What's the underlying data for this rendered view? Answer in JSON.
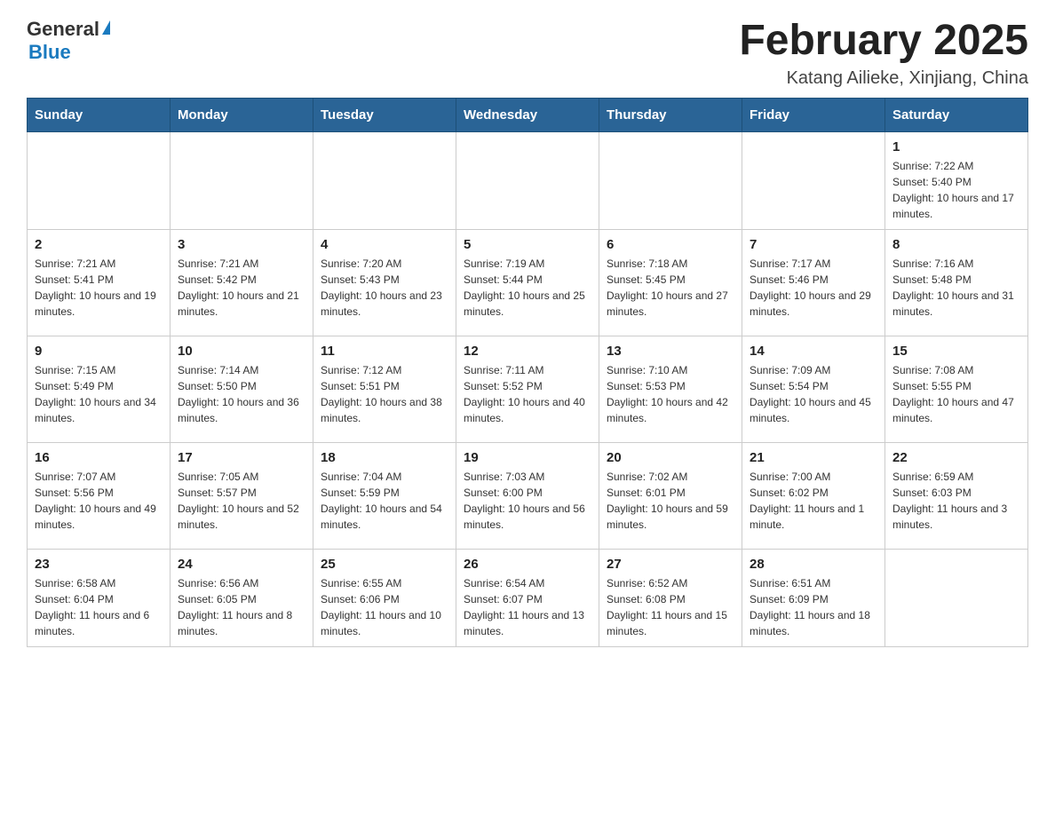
{
  "logo": {
    "general": "General",
    "blue": "Blue"
  },
  "title": "February 2025",
  "subtitle": "Katang Ailieke, Xinjiang, China",
  "weekdays": [
    "Sunday",
    "Monday",
    "Tuesday",
    "Wednesday",
    "Thursday",
    "Friday",
    "Saturday"
  ],
  "weeks": [
    [
      {
        "day": "",
        "sunrise": "",
        "sunset": "",
        "daylight": ""
      },
      {
        "day": "",
        "sunrise": "",
        "sunset": "",
        "daylight": ""
      },
      {
        "day": "",
        "sunrise": "",
        "sunset": "",
        "daylight": ""
      },
      {
        "day": "",
        "sunrise": "",
        "sunset": "",
        "daylight": ""
      },
      {
        "day": "",
        "sunrise": "",
        "sunset": "",
        "daylight": ""
      },
      {
        "day": "",
        "sunrise": "",
        "sunset": "",
        "daylight": ""
      },
      {
        "day": "1",
        "sunrise": "Sunrise: 7:22 AM",
        "sunset": "Sunset: 5:40 PM",
        "daylight": "Daylight: 10 hours and 17 minutes."
      }
    ],
    [
      {
        "day": "2",
        "sunrise": "Sunrise: 7:21 AM",
        "sunset": "Sunset: 5:41 PM",
        "daylight": "Daylight: 10 hours and 19 minutes."
      },
      {
        "day": "3",
        "sunrise": "Sunrise: 7:21 AM",
        "sunset": "Sunset: 5:42 PM",
        "daylight": "Daylight: 10 hours and 21 minutes."
      },
      {
        "day": "4",
        "sunrise": "Sunrise: 7:20 AM",
        "sunset": "Sunset: 5:43 PM",
        "daylight": "Daylight: 10 hours and 23 minutes."
      },
      {
        "day": "5",
        "sunrise": "Sunrise: 7:19 AM",
        "sunset": "Sunset: 5:44 PM",
        "daylight": "Daylight: 10 hours and 25 minutes."
      },
      {
        "day": "6",
        "sunrise": "Sunrise: 7:18 AM",
        "sunset": "Sunset: 5:45 PM",
        "daylight": "Daylight: 10 hours and 27 minutes."
      },
      {
        "day": "7",
        "sunrise": "Sunrise: 7:17 AM",
        "sunset": "Sunset: 5:46 PM",
        "daylight": "Daylight: 10 hours and 29 minutes."
      },
      {
        "day": "8",
        "sunrise": "Sunrise: 7:16 AM",
        "sunset": "Sunset: 5:48 PM",
        "daylight": "Daylight: 10 hours and 31 minutes."
      }
    ],
    [
      {
        "day": "9",
        "sunrise": "Sunrise: 7:15 AM",
        "sunset": "Sunset: 5:49 PM",
        "daylight": "Daylight: 10 hours and 34 minutes."
      },
      {
        "day": "10",
        "sunrise": "Sunrise: 7:14 AM",
        "sunset": "Sunset: 5:50 PM",
        "daylight": "Daylight: 10 hours and 36 minutes."
      },
      {
        "day": "11",
        "sunrise": "Sunrise: 7:12 AM",
        "sunset": "Sunset: 5:51 PM",
        "daylight": "Daylight: 10 hours and 38 minutes."
      },
      {
        "day": "12",
        "sunrise": "Sunrise: 7:11 AM",
        "sunset": "Sunset: 5:52 PM",
        "daylight": "Daylight: 10 hours and 40 minutes."
      },
      {
        "day": "13",
        "sunrise": "Sunrise: 7:10 AM",
        "sunset": "Sunset: 5:53 PM",
        "daylight": "Daylight: 10 hours and 42 minutes."
      },
      {
        "day": "14",
        "sunrise": "Sunrise: 7:09 AM",
        "sunset": "Sunset: 5:54 PM",
        "daylight": "Daylight: 10 hours and 45 minutes."
      },
      {
        "day": "15",
        "sunrise": "Sunrise: 7:08 AM",
        "sunset": "Sunset: 5:55 PM",
        "daylight": "Daylight: 10 hours and 47 minutes."
      }
    ],
    [
      {
        "day": "16",
        "sunrise": "Sunrise: 7:07 AM",
        "sunset": "Sunset: 5:56 PM",
        "daylight": "Daylight: 10 hours and 49 minutes."
      },
      {
        "day": "17",
        "sunrise": "Sunrise: 7:05 AM",
        "sunset": "Sunset: 5:57 PM",
        "daylight": "Daylight: 10 hours and 52 minutes."
      },
      {
        "day": "18",
        "sunrise": "Sunrise: 7:04 AM",
        "sunset": "Sunset: 5:59 PM",
        "daylight": "Daylight: 10 hours and 54 minutes."
      },
      {
        "day": "19",
        "sunrise": "Sunrise: 7:03 AM",
        "sunset": "Sunset: 6:00 PM",
        "daylight": "Daylight: 10 hours and 56 minutes."
      },
      {
        "day": "20",
        "sunrise": "Sunrise: 7:02 AM",
        "sunset": "Sunset: 6:01 PM",
        "daylight": "Daylight: 10 hours and 59 minutes."
      },
      {
        "day": "21",
        "sunrise": "Sunrise: 7:00 AM",
        "sunset": "Sunset: 6:02 PM",
        "daylight": "Daylight: 11 hours and 1 minute."
      },
      {
        "day": "22",
        "sunrise": "Sunrise: 6:59 AM",
        "sunset": "Sunset: 6:03 PM",
        "daylight": "Daylight: 11 hours and 3 minutes."
      }
    ],
    [
      {
        "day": "23",
        "sunrise": "Sunrise: 6:58 AM",
        "sunset": "Sunset: 6:04 PM",
        "daylight": "Daylight: 11 hours and 6 minutes."
      },
      {
        "day": "24",
        "sunrise": "Sunrise: 6:56 AM",
        "sunset": "Sunset: 6:05 PM",
        "daylight": "Daylight: 11 hours and 8 minutes."
      },
      {
        "day": "25",
        "sunrise": "Sunrise: 6:55 AM",
        "sunset": "Sunset: 6:06 PM",
        "daylight": "Daylight: 11 hours and 10 minutes."
      },
      {
        "day": "26",
        "sunrise": "Sunrise: 6:54 AM",
        "sunset": "Sunset: 6:07 PM",
        "daylight": "Daylight: 11 hours and 13 minutes."
      },
      {
        "day": "27",
        "sunrise": "Sunrise: 6:52 AM",
        "sunset": "Sunset: 6:08 PM",
        "daylight": "Daylight: 11 hours and 15 minutes."
      },
      {
        "day": "28",
        "sunrise": "Sunrise: 6:51 AM",
        "sunset": "Sunset: 6:09 PM",
        "daylight": "Daylight: 11 hours and 18 minutes."
      },
      {
        "day": "",
        "sunrise": "",
        "sunset": "",
        "daylight": ""
      }
    ]
  ]
}
